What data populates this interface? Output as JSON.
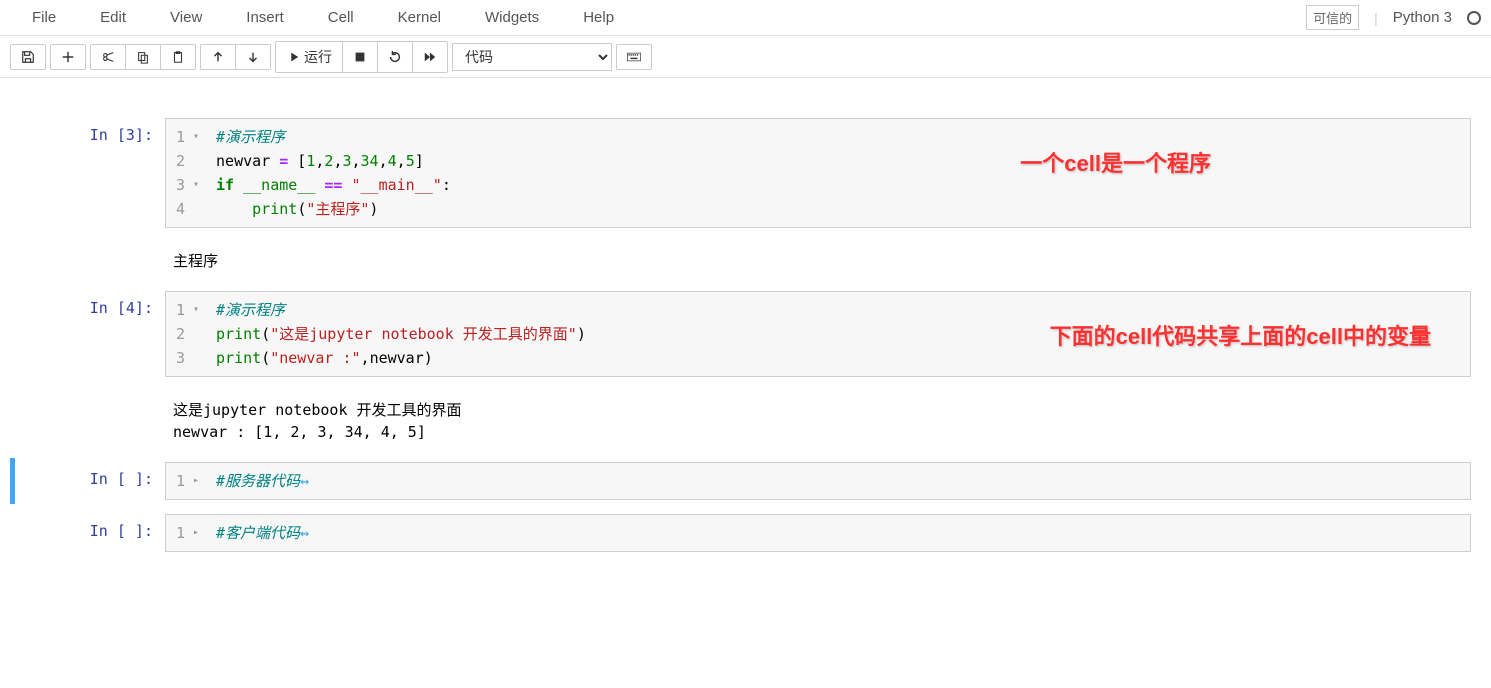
{
  "menubar": {
    "items": [
      "File",
      "Edit",
      "View",
      "Insert",
      "Cell",
      "Kernel",
      "Widgets",
      "Help"
    ],
    "trusted": "可信的",
    "kernel": "Python 3"
  },
  "toolbar": {
    "run_label": "运行",
    "cell_type": "代码"
  },
  "annotations": {
    "a1": "一个cell是一个程序",
    "a2": "下面的cell代码共享上面的cell中的变量"
  },
  "cells": [
    {
      "prompt": "In [3]:",
      "lines": [
        {
          "n": "1",
          "fold": "▾",
          "tokens": [
            [
              "comment",
              "#演示程序"
            ]
          ]
        },
        {
          "n": "2",
          "fold": "",
          "tokens": [
            [
              "var",
              "newvar "
            ],
            [
              "op",
              "="
            ],
            [
              "punct",
              " ["
            ],
            [
              "num",
              "1"
            ],
            [
              "punct",
              ","
            ],
            [
              "num",
              "2"
            ],
            [
              "punct",
              ","
            ],
            [
              "num",
              "3"
            ],
            [
              "punct",
              ","
            ],
            [
              "num",
              "34"
            ],
            [
              "punct",
              ","
            ],
            [
              "num",
              "4"
            ],
            [
              "punct",
              ","
            ],
            [
              "num",
              "5"
            ],
            [
              "punct",
              "]"
            ]
          ]
        },
        {
          "n": "3",
          "fold": "▾",
          "tokens": [
            [
              "keyword",
              "if"
            ],
            [
              "punct",
              " "
            ],
            [
              "builtin",
              "__name__"
            ],
            [
              "punct",
              " "
            ],
            [
              "op",
              "=="
            ],
            [
              "punct",
              " "
            ],
            [
              "string",
              "\"__main__\""
            ],
            [
              "punct",
              ":"
            ]
          ]
        },
        {
          "n": "4",
          "fold": "",
          "tokens": [
            [
              "punct",
              "    "
            ],
            [
              "builtin",
              "print"
            ],
            [
              "punct",
              "("
            ],
            [
              "string",
              "\"主程序\""
            ],
            [
              "punct",
              ")"
            ]
          ]
        }
      ],
      "output": "主程序"
    },
    {
      "prompt": "In [4]:",
      "lines": [
        {
          "n": "1",
          "fold": "▾",
          "tokens": [
            [
              "comment",
              "#演示程序"
            ]
          ]
        },
        {
          "n": "2",
          "fold": "",
          "tokens": [
            [
              "builtin",
              "print"
            ],
            [
              "punct",
              "("
            ],
            [
              "string",
              "\"这是jupyter notebook 开发工具的界面\""
            ],
            [
              "punct",
              ")"
            ]
          ]
        },
        {
          "n": "3",
          "fold": "",
          "tokens": [
            [
              "builtin",
              "print"
            ],
            [
              "punct",
              "("
            ],
            [
              "string",
              "\"newvar :\""
            ],
            [
              "punct",
              ","
            ],
            [
              "var",
              "newvar"
            ],
            [
              "punct",
              ")"
            ]
          ]
        }
      ],
      "output": "这是jupyter notebook 开发工具的界面\nnewvar : [1, 2, 3, 34, 4, 5]"
    },
    {
      "prompt": "In [ ]:",
      "selected": true,
      "lines": [
        {
          "n": "1",
          "fold": "▸",
          "tokens": [
            [
              "comment",
              "#服务器代码"
            ],
            [
              "arrow",
              "↔"
            ]
          ]
        }
      ]
    },
    {
      "prompt": "In [ ]:",
      "lines": [
        {
          "n": "1",
          "fold": "▸",
          "tokens": [
            [
              "comment",
              "#客户端代码"
            ],
            [
              "arrow",
              "↔"
            ]
          ]
        }
      ]
    }
  ]
}
